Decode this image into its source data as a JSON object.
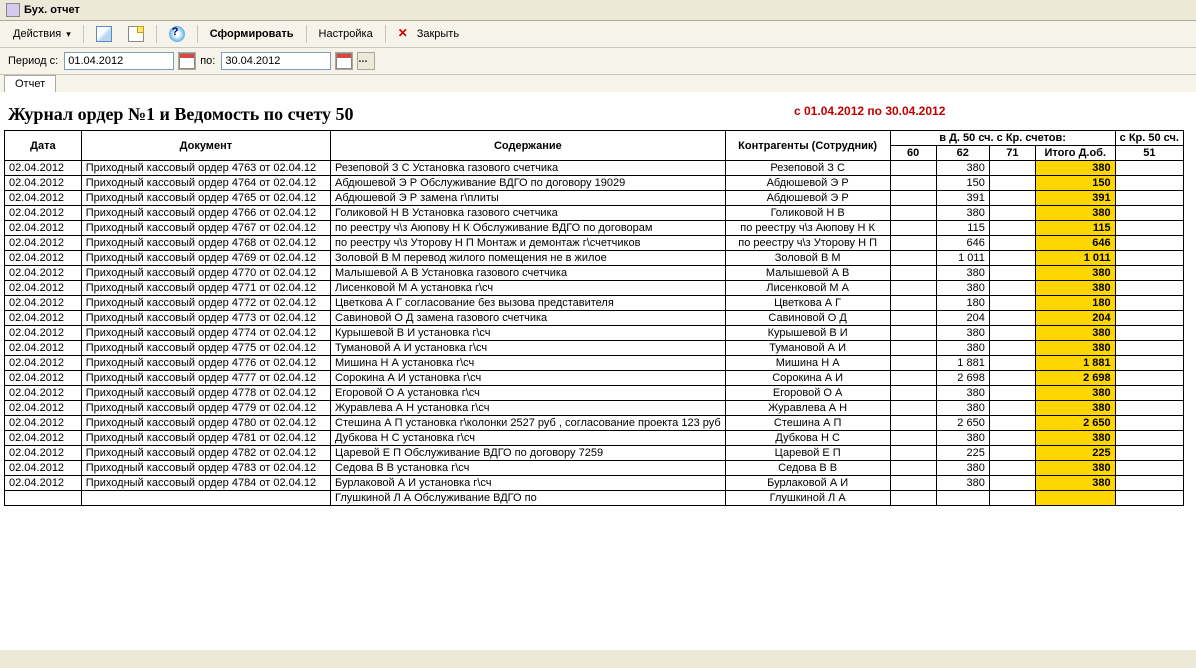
{
  "window": {
    "title": "Бух. отчет"
  },
  "toolbar": {
    "actions": "Действия",
    "form": "Сформировать",
    "settings": "Настройка",
    "close": "Закрыть"
  },
  "period": {
    "label_from": "Период с:",
    "from": "01.04.2012",
    "label_to": "по:",
    "to": "30.04.2012"
  },
  "tab": {
    "report": "Отчет"
  },
  "report": {
    "title": "Журнал ордер №1 и Ведомость по счету 50",
    "range": "с 01.04.2012 по 30.04.2012",
    "group_header": "в Д. 50 сч. с Кр. счетов:",
    "kr_header": "с Кр. 50 сч.",
    "cols": {
      "date": "Дата",
      "doc": "Документ",
      "desc": "Содержание",
      "contr": "Контрагенты (Сотрудник)",
      "c60": "60",
      "c62": "62",
      "c71": "71",
      "total": "Итого Д.об.",
      "c51": "51"
    },
    "rows": [
      {
        "date": "02.04.2012",
        "doc": "Приходный кассовый ордер 4763 от 02.04.12",
        "desc": "Резеповой З С   Установка газового счетчика",
        "contr": "Резеповой З С",
        "c60": "",
        "c62": "380",
        "c71": "",
        "total": "380",
        "c51": ""
      },
      {
        "date": "02.04.2012",
        "doc": "Приходный кассовый ордер 4764 от 02.04.12",
        "desc": "Абдюшевой Э Р  Обслуживание ВДГО по договору 19029",
        "contr": "Абдюшевой Э Р",
        "c60": "",
        "c62": "150",
        "c71": "",
        "total": "150",
        "c51": ""
      },
      {
        "date": "02.04.2012",
        "doc": "Приходный кассовый ордер 4765 от 02.04.12",
        "desc": "Абдюшевой Э Р    замена г\\плиты",
        "contr": "Абдюшевой Э Р",
        "c60": "",
        "c62": "391",
        "c71": "",
        "total": "391",
        "c51": ""
      },
      {
        "date": "02.04.2012",
        "doc": "Приходный кассовый ордер 4766 от 02.04.12",
        "desc": "Голиковой Н В    Установка газового счетчика",
        "contr": "Голиковой Н В",
        "c60": "",
        "c62": "380",
        "c71": "",
        "total": "380",
        "c51": ""
      },
      {
        "date": "02.04.2012",
        "doc": "Приходный кассовый ордер 4767 от 02.04.12",
        "desc": "по реестру ч\\з Аюпову Н К   Обслуживание ВДГО по договорам",
        "contr": "по реестру ч\\з Аюпову Н К",
        "c60": "",
        "c62": "115",
        "c71": "",
        "total": "115",
        "c51": ""
      },
      {
        "date": "02.04.2012",
        "doc": "Приходный кассовый ордер 4768 от 02.04.12",
        "desc": "по реестру ч\\з Уторову Н П  Монтаж и демонтаж г\\счетчиков",
        "contr": "по реестру ч\\з Уторову Н П",
        "c60": "",
        "c62": "646",
        "c71": "",
        "total": "646",
        "c51": ""
      },
      {
        "date": "02.04.2012",
        "doc": "Приходный кассовый ордер 4769 от 02.04.12",
        "desc": "Золовой В М   перевод жилого помещения не в жилое",
        "contr": "Золовой В М",
        "c60": "",
        "c62": "1 011",
        "c71": "",
        "total": "1 011",
        "c51": ""
      },
      {
        "date": "02.04.2012",
        "doc": "Приходный кассовый ордер 4770 от 02.04.12",
        "desc": "Малышевой А В    Установка газового счетчика",
        "contr": "Малышевой А В",
        "c60": "",
        "c62": "380",
        "c71": "",
        "total": "380",
        "c51": ""
      },
      {
        "date": "02.04.2012",
        "doc": "Приходный кассовый ордер 4771 от 02.04.12",
        "desc": "Лисенковой М А  установка г\\сч",
        "contr": "Лисенковой М А",
        "c60": "",
        "c62": "380",
        "c71": "",
        "total": "380",
        "c51": ""
      },
      {
        "date": "02.04.2012",
        "doc": "Приходный кассовый ордер 4772 от 02.04.12",
        "desc": "Цветкова А Г   согласование без вызова представителя",
        "contr": "Цветкова А Г",
        "c60": "",
        "c62": "180",
        "c71": "",
        "total": "180",
        "c51": ""
      },
      {
        "date": "02.04.2012",
        "doc": "Приходный кассовый ордер 4773 от 02.04.12",
        "desc": "Савиновой О Д   замена  газового счетчика",
        "contr": "Савиновой О Д",
        "c60": "",
        "c62": "204",
        "c71": "",
        "total": "204",
        "c51": ""
      },
      {
        "date": "02.04.2012",
        "doc": "Приходный кассовый ордер 4774 от 02.04.12",
        "desc": "Курышевой В И   установка г\\сч",
        "contr": "Курышевой В И",
        "c60": "",
        "c62": "380",
        "c71": "",
        "total": "380",
        "c51": ""
      },
      {
        "date": "02.04.2012",
        "doc": "Приходный кассовый ордер 4775 от 02.04.12",
        "desc": "Тумановой А И   установка г\\сч",
        "contr": "Тумановой А И",
        "c60": "",
        "c62": "380",
        "c71": "",
        "total": "380",
        "c51": ""
      },
      {
        "date": "02.04.2012",
        "doc": "Приходный кассовый ордер 4776 от 02.04.12",
        "desc": "Мишина Н А    установка г\\сч",
        "contr": "Мишина Н А",
        "c60": "",
        "c62": "1 881",
        "c71": "",
        "total": "1 881",
        "c51": ""
      },
      {
        "date": "02.04.2012",
        "doc": "Приходный кассовый ордер 4777 от 02.04.12",
        "desc": "Сорокина А И    установка г\\сч",
        "contr": "Сорокина А И",
        "c60": "",
        "c62": "2 698",
        "c71": "",
        "total": "2 698",
        "c51": ""
      },
      {
        "date": "02.04.2012",
        "doc": "Приходный кассовый ордер 4778 от 02.04.12",
        "desc": "Егоровой О А    установка г\\сч",
        "contr": "Егоровой О А",
        "c60": "",
        "c62": "380",
        "c71": "",
        "total": "380",
        "c51": ""
      },
      {
        "date": "02.04.2012",
        "doc": "Приходный кассовый ордер 4779 от 02.04.12",
        "desc": "Журавлева А Н  установка г\\сч",
        "contr": "Журавлева А Н",
        "c60": "",
        "c62": "380",
        "c71": "",
        "total": "380",
        "c51": ""
      },
      {
        "date": "02.04.2012",
        "doc": "Приходный кассовый ордер 4780 от 02.04.12",
        "desc": "Стешина А П установка г\\колонки  2527 руб , согласование  проекта 123 руб",
        "contr": "Стешина А П",
        "c60": "",
        "c62": "2 650",
        "c71": "",
        "total": "2 650",
        "c51": ""
      },
      {
        "date": "02.04.2012",
        "doc": "Приходный кассовый ордер 4781 от 02.04.12",
        "desc": "Дубкова Н С  установка г\\сч",
        "contr": "Дубкова Н С",
        "c60": "",
        "c62": "380",
        "c71": "",
        "total": "380",
        "c51": ""
      },
      {
        "date": "02.04.2012",
        "doc": "Приходный кассовый ордер 4782 от 02.04.12",
        "desc": "Царевой Е П  Обслуживание ВДГО по договору 7259",
        "contr": "Царевой Е П",
        "c60": "",
        "c62": "225",
        "c71": "",
        "total": "225",
        "c51": ""
      },
      {
        "date": "02.04.2012",
        "doc": "Приходный кассовый ордер 4783 от 02.04.12",
        "desc": "Седова В В   установка г\\сч",
        "contr": "Седова В В",
        "c60": "",
        "c62": "380",
        "c71": "",
        "total": "380",
        "c51": ""
      },
      {
        "date": "02.04.2012",
        "doc": "Приходный кассовый ордер 4784 от 02.04.12",
        "desc": "Бурлаковой А И   установка г\\сч",
        "contr": "Бурлаковой А И",
        "c60": "",
        "c62": "380",
        "c71": "",
        "total": "380",
        "c51": ""
      },
      {
        "date": "",
        "doc": "",
        "desc": "Глушкиной Л А  Обслуживание ВДГО по",
        "contr": "Глушкиной Л А",
        "c60": "",
        "c62": "",
        "c71": "",
        "total": "",
        "c51": ""
      }
    ]
  }
}
